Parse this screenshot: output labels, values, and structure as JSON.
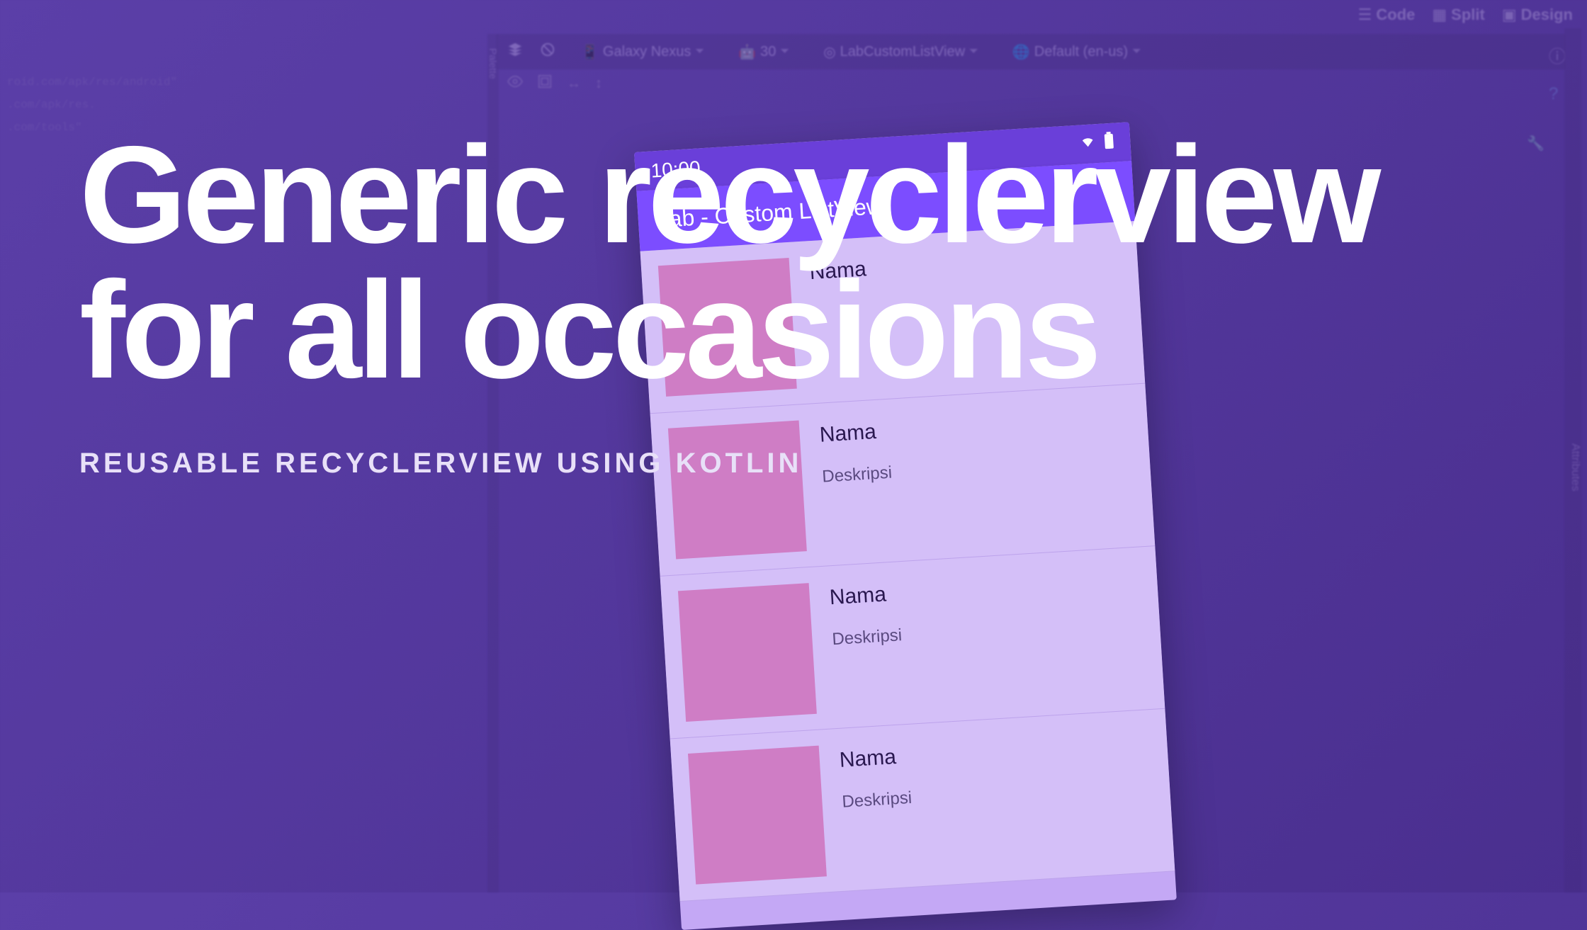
{
  "ide": {
    "top_tabs": {
      "code": "Code",
      "split": "Split",
      "design": "Design"
    },
    "toolbar": {
      "device": "Galaxy Nexus",
      "api": "30",
      "app": "LabCustomListView",
      "locale": "Default (en-us)"
    },
    "right_rail": "Attributes",
    "left_rail": "Palette",
    "code_lines": [
      "roid.com/apk/res/android\"",
      ".com/apk/res.",
      ".com/tools\""
    ]
  },
  "phone": {
    "time": "10:00",
    "app_title": "Lab - Custom ListView",
    "items": [
      {
        "name": "Nama",
        "desc": ""
      },
      {
        "name": "Nama",
        "desc": "Deskripsi"
      },
      {
        "name": "Nama",
        "desc": "Deskripsi"
      },
      {
        "name": "Nama",
        "desc": "Deskripsi"
      }
    ]
  },
  "headline": {
    "title": "Generic recyclerview for all occasions",
    "subtitle": "Reusable Recyclerview using Kotlin"
  }
}
